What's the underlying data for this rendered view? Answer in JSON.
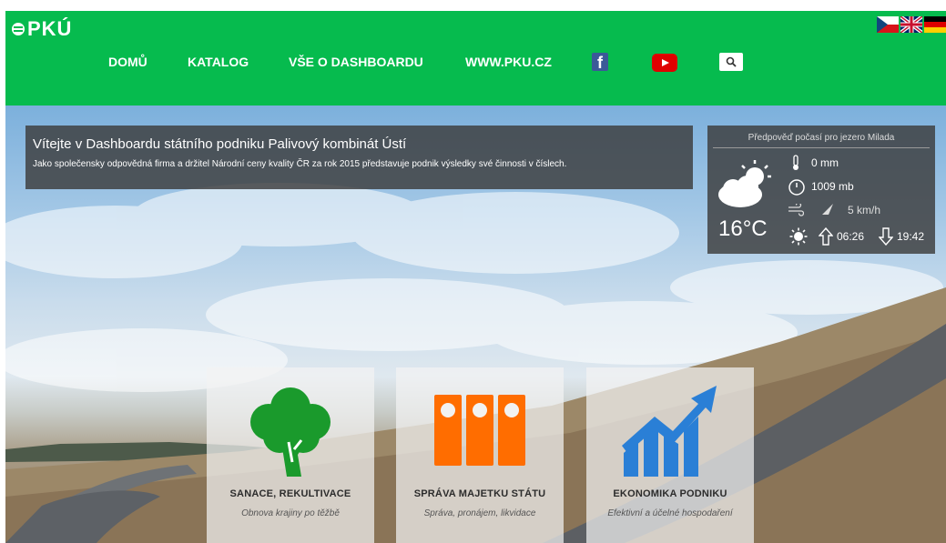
{
  "header": {
    "logo_text": "PKÚ",
    "nav": [
      {
        "label": "DOMŮ"
      },
      {
        "label": "KATALOG"
      },
      {
        "label": "VŠE O DASHBOARDU"
      },
      {
        "label": "WWW.PKU.CZ"
      }
    ],
    "facebook_glyph": "f",
    "icons": [
      "facebook-icon",
      "youtube-icon",
      "search-icon"
    ],
    "flags": [
      "cz-flag-icon",
      "uk-flag-icon",
      "de-flag-icon"
    ],
    "brand_color": "#06bb4e"
  },
  "welcome": {
    "title": "Vítejte v Dashboardu státního podniku Palivový kombinát Ústí",
    "text": "Jako společensky odpovědná firma a držitel Národní ceny kvality ČR za rok 2015 představuje podnik výsledky své činnosti v číslech."
  },
  "weather": {
    "title": "Předpověď počasí pro jezero Milada",
    "temperature": "16°C",
    "precipitation": "0 mm",
    "pressure": "1009 mb",
    "wind": "5 km/h",
    "sunrise": "06:26",
    "sunset": "19:42"
  },
  "cards": [
    {
      "title": "SANACE, REKULTIVACE",
      "subtitle": "Obnova krajiny po těžbě",
      "icon": "tree-icon",
      "color": "#1a9a2c"
    },
    {
      "title": "SPRÁVA MAJETKU STÁTU",
      "subtitle": "Správa, pronájem, likvidace",
      "icon": "binders-icon",
      "color": "#ff6d00"
    },
    {
      "title": "EKONOMIKA PODNIKU",
      "subtitle": "Efektivní a účelné hospodaření",
      "icon": "growth-chart-icon",
      "color": "#2a7fd6"
    }
  ]
}
